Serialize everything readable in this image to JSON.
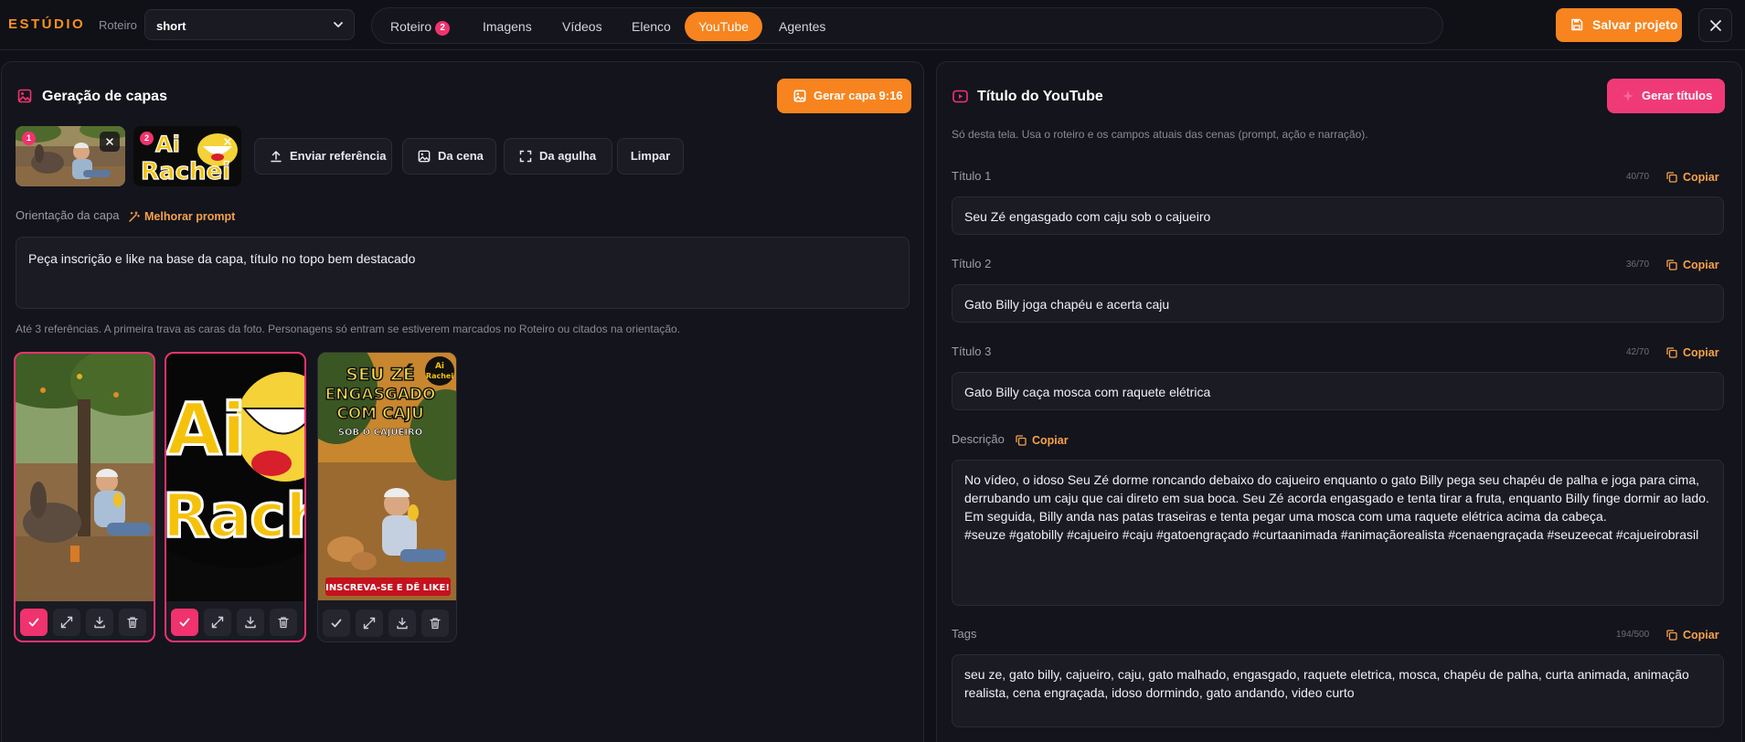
{
  "app": {
    "brand": "ESTÚDIO"
  },
  "roteiro": {
    "label": "Roteiro",
    "value": "short"
  },
  "nav": {
    "tabs": [
      {
        "label": "Roteiro",
        "badge": "2"
      },
      {
        "label": "Imagens"
      },
      {
        "label": "Vídeos"
      },
      {
        "label": "Elenco"
      },
      {
        "label": "YouTube",
        "active": true
      },
      {
        "label": "Agentes"
      }
    ]
  },
  "header": {
    "save_label": "Salvar projeto"
  },
  "covers": {
    "title": "Geração de capas",
    "generate_label": "Gerar capa 9:16",
    "references": [
      {
        "number": "1"
      },
      {
        "number": "2",
        "logo_text_1": "Ai",
        "logo_text_2": "Rachei"
      }
    ],
    "buttons": {
      "upload": "Enviar referência",
      "from_scene": "Da cena",
      "from_needle": "Da agulha",
      "clear": "Limpar"
    },
    "orientation_label": "Orientação da capa",
    "improve_label": "Melhorar prompt",
    "orientation_value": "Peça inscrição e like na base da capa, título no topo bem destacado",
    "help": "Até 3 referências. A primeira trava as caras da foto. Personagens só entram se estiverem marcados no Roteiro ou citados na orientação.",
    "results": [
      {
        "selected": true
      },
      {
        "selected": true,
        "logo_text_1": "Ai",
        "logo_text_2": "Rachei"
      },
      {
        "selected": false,
        "headline_1": "SEU ZÉ",
        "headline_2": "ENGASGADO",
        "headline_3": "COM CAJU",
        "headline_4": "SOB O CAJUEIRO",
        "logo_text_1": "Ai",
        "logo_text_2": "Rachei",
        "cta": "INSCREVA-SE E DÊ LIKE!"
      }
    ]
  },
  "youtube": {
    "title": "Título do YouTube",
    "generate_label": "Gerar títulos",
    "note": "Só desta tela. Usa o roteiro e os campos atuais das cenas (prompt, ação e narração).",
    "copy_label": "Copiar",
    "titles": [
      {
        "label": "Título 1",
        "counter": "40/70",
        "value": "Seu Zé engasgado com caju sob o cajueiro"
      },
      {
        "label": "Título 2",
        "counter": "36/70",
        "value": "Gato Billy joga chapéu e acerta caju"
      },
      {
        "label": "Título 3",
        "counter": "42/70",
        "value": "Gato Billy caça mosca com raquete elétrica"
      }
    ],
    "description": {
      "label": "Descrição",
      "value": "No vídeo, o idoso Seu Zé dorme roncando debaixo do cajueiro enquanto o gato Billy pega seu chapéu de palha e joga para cima,\nderrubando um caju que cai direto em sua boca. Seu Zé acorda engasgado e tenta tirar a fruta, enquanto Billy finge dormir ao lado.\nEm seguida, Billy anda nas patas traseiras e tenta pegar uma mosca com uma raquete elétrica acima da cabeça.\n#seuze #gatobilly #cajueiro #caju #gatoengraçado #curtaanimada #animaçãorealista #cenaengraçada #seuzeecat #cajueirobrasil"
    },
    "tags": {
      "label": "Tags",
      "counter": "194/500",
      "value": "seu ze, gato billy, cajueiro, caju, gato malhado, engasgado, raquete eletrica, mosca, chapéu de palha, curta animada, animação\nrealista, cena engraçada, idoso dormindo, gato andando, video curto"
    }
  }
}
